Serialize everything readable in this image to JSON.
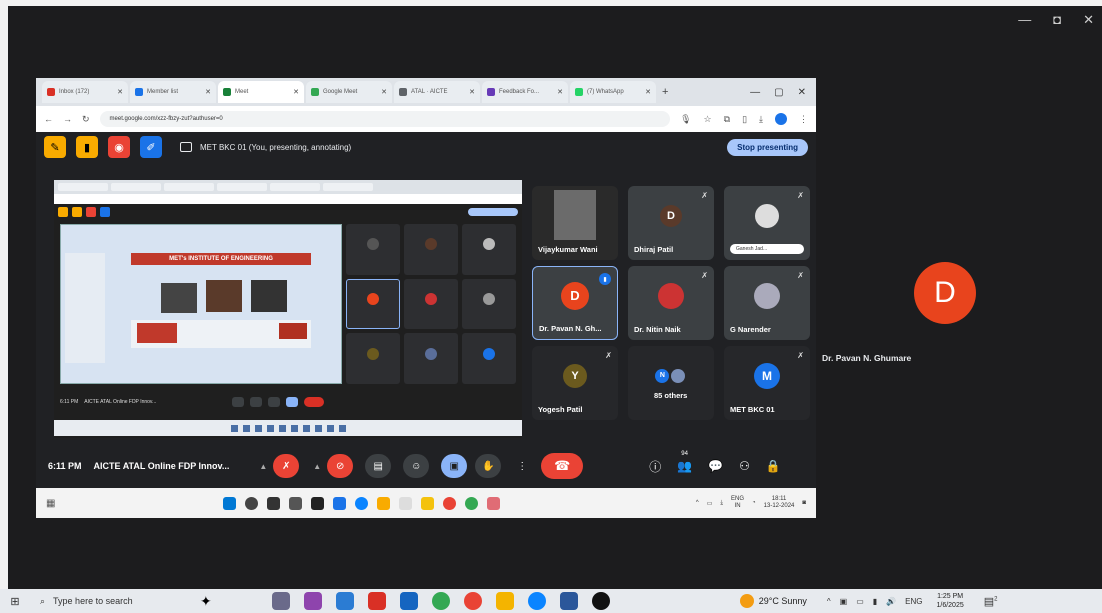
{
  "outer_window": {
    "minimize": "—",
    "maximize": "◘",
    "close": "✕"
  },
  "browser": {
    "tabs": [
      {
        "label": "Inbox (172)",
        "color": "#d93025"
      },
      {
        "label": "Member list",
        "color": "#1a73e8"
      },
      {
        "label": "Meet",
        "color": "#188038",
        "active": true
      },
      {
        "label": "Google Meet",
        "color": "#34a853"
      },
      {
        "label": "ATAL · AICTE",
        "color": "#5f6368"
      },
      {
        "label": "Feedback Fo...",
        "color": "#673ab7"
      },
      {
        "label": "(7) WhatsApp",
        "color": "#25d366"
      }
    ],
    "new_tab": "+",
    "url": "meet.google.com/xzz-fbzy-zut?authuser=0"
  },
  "meet": {
    "presenting_title": "MET BKC 01 (You, presenting, annotating)",
    "stop_presenting": "Stop presenting",
    "participants": [
      {
        "name": "Vijaykumar Wani",
        "type": "video"
      },
      {
        "name": "Dhiraj Patil",
        "initial": "D",
        "avatar_color": "#5a3a2a"
      },
      {
        "name": "",
        "type": "photo",
        "chip": "Ganesh Jad..."
      },
      {
        "name": "Dr. Pavan N. Gh...",
        "initial": "D",
        "avatar_color": "#e8441d",
        "speaking": true
      },
      {
        "name": "Dr. Nitin Naik",
        "type": "photo"
      },
      {
        "name": "G Narender",
        "type": "photo"
      },
      {
        "name": "Yogesh Patil",
        "initial": "Y",
        "avatar_color": "#6b5a1e"
      },
      {
        "name": "85 others",
        "initial": "N"
      },
      {
        "name": "MET BKC 01",
        "initial": "M",
        "avatar_color": "#1a73e8"
      }
    ],
    "controls": {
      "time": "6:11 PM",
      "meeting_title": "AICTE ATAL Online FDP Innov...",
      "people_count": "94"
    },
    "big_avatar": {
      "initial": "D",
      "name": "Dr. Pavan N. Ghumare",
      "color": "#e8441d"
    }
  },
  "nested": {
    "slide_header": "MET's INSTITUTE OF ENGINEERING",
    "time": "6:11 PM",
    "title": "AICTE ATAL Online FDP Innov..."
  },
  "inner_taskbar": {
    "lang": "ENG\nIN",
    "clock_time": "18:11",
    "clock_date": "13-12-2024"
  },
  "taskbar": {
    "search_placeholder": "Type here to search",
    "weather": "29°C  Sunny",
    "lang": "ENG",
    "time": "1:25 PM",
    "date": "1/6/2025",
    "notification_count": "2"
  }
}
